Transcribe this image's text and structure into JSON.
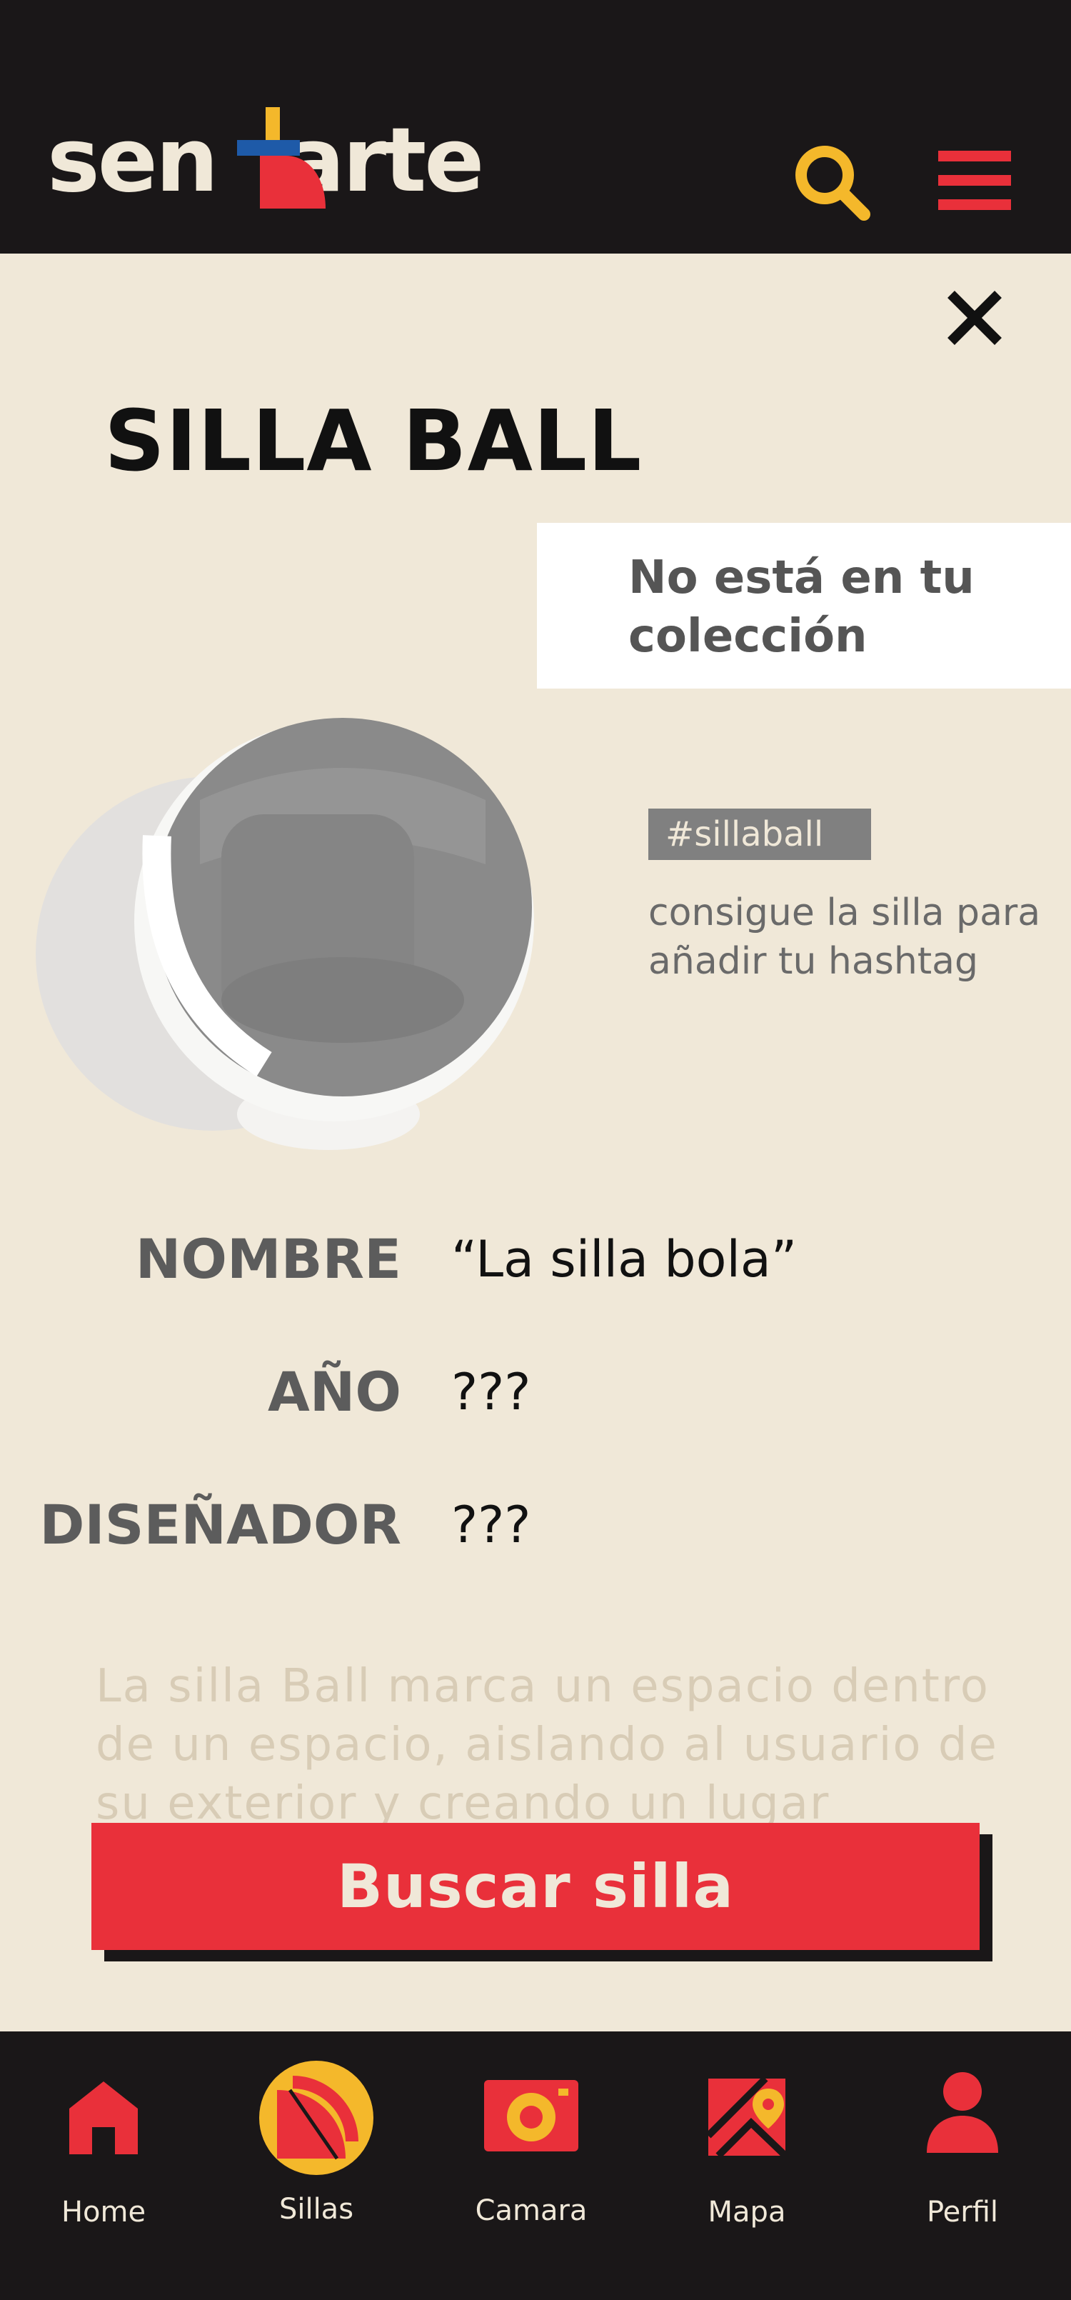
{
  "header": {
    "logo_left": "sen",
    "logo_right": "arte",
    "colors": {
      "background": "#1a1718",
      "accent_yellow": "#f4b82b",
      "accent_red": "#e9303a",
      "accent_blue": "#1e5aa8",
      "cream": "#f0e8d8"
    }
  },
  "detail": {
    "title": "SILLA BALL",
    "collection_status": "No está en tu colección",
    "hashtag": "#sillaball",
    "hashtag_hint": "consigue la silla para añadir tu hashtag",
    "fields": [
      {
        "label": "NOMBRE",
        "value": "“La silla bola”"
      },
      {
        "label": "AÑO",
        "value": "???"
      },
      {
        "label": "DISEÑADOR",
        "value": "???"
      }
    ],
    "description": "La silla Ball marca un espacio dentro de un espacio, aislando al usuario de su exterior y creando un lugar óptimo",
    "action_button": "Buscar silla"
  },
  "nav": {
    "items": [
      {
        "label": "Home",
        "icon": "home-icon"
      },
      {
        "label": "Sillas",
        "icon": "chair-icon",
        "active": true
      },
      {
        "label": "Camara",
        "icon": "camera-icon"
      },
      {
        "label": "Mapa",
        "icon": "map-icon"
      },
      {
        "label": "Perfil",
        "icon": "profile-icon"
      }
    ]
  }
}
